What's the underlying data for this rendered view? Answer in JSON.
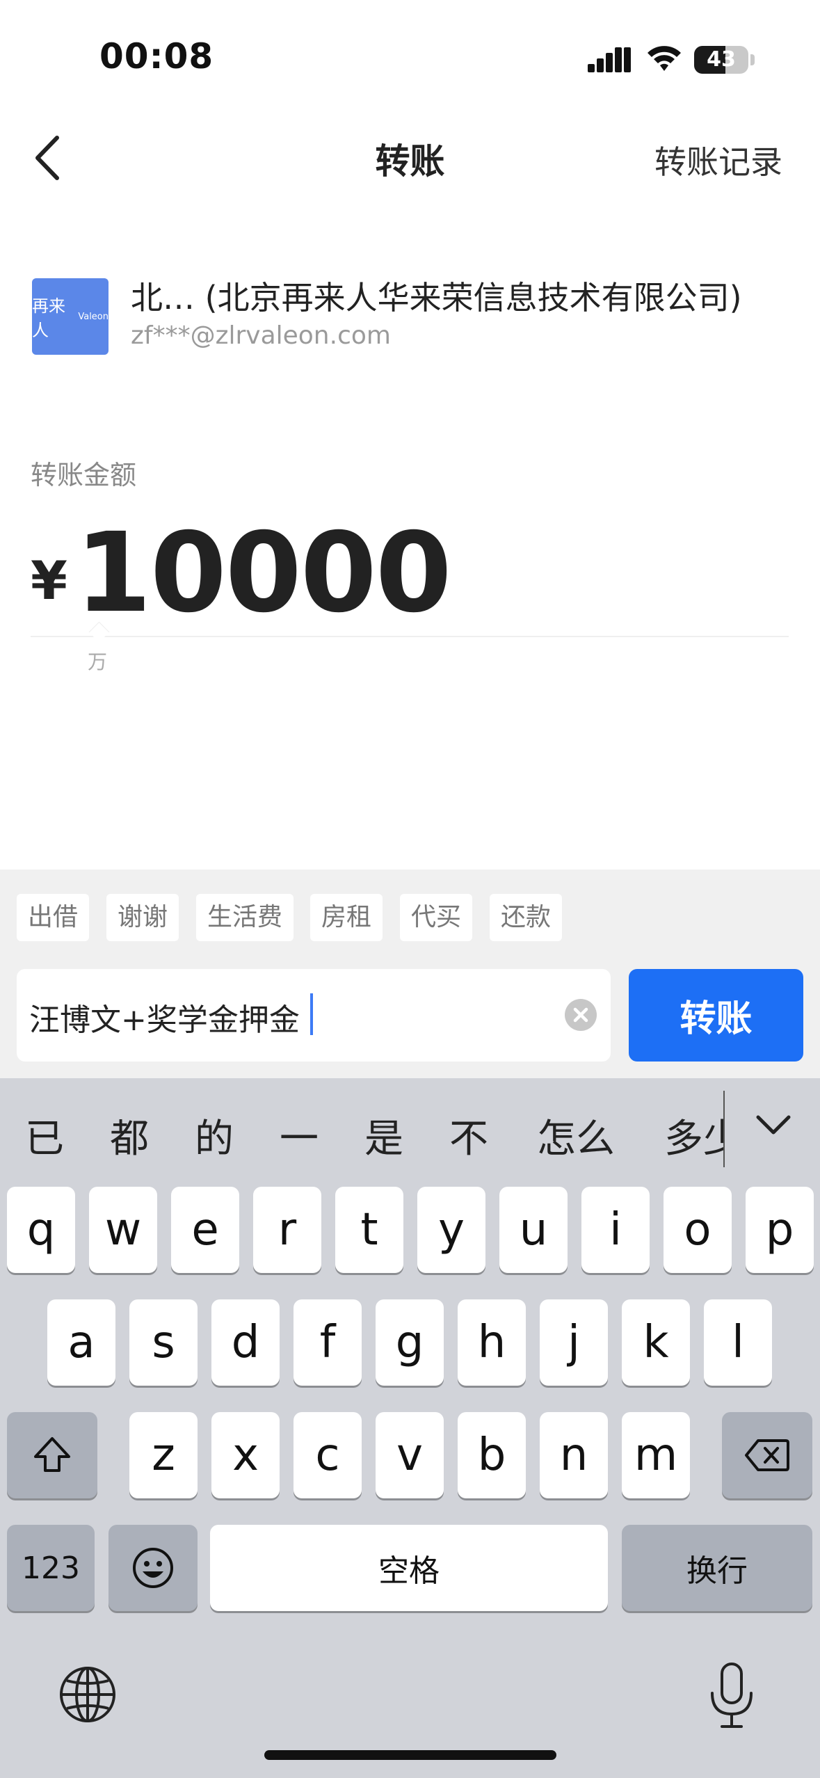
{
  "status_bar": {
    "time": "00:08",
    "battery": "43"
  },
  "nav": {
    "title": "转账",
    "record_link": "转账记录"
  },
  "payee": {
    "avatar_text": "再来人",
    "avatar_sup": "Valeon",
    "name": "北… (北京再来人华来荣信息技术有限公司)",
    "account": "zf***@zlrvaleon.com"
  },
  "amount": {
    "label": "转账金额",
    "currency": "¥",
    "value": "10000",
    "unit_hint": "万"
  },
  "remark": {
    "chips": [
      "出借",
      "谢谢",
      "生活费",
      "房租",
      "代买",
      "还款"
    ],
    "value": "汪博文+奖学金押金",
    "submit_label": "转账"
  },
  "keyboard": {
    "candidates": [
      "已",
      "都",
      "的",
      "一",
      "是",
      "不",
      "怎么",
      "多少"
    ],
    "row1": [
      "q",
      "w",
      "e",
      "r",
      "t",
      "y",
      "u",
      "i",
      "o",
      "p"
    ],
    "row2": [
      "a",
      "s",
      "d",
      "f",
      "g",
      "h",
      "j",
      "k",
      "l"
    ],
    "row3": [
      "z",
      "x",
      "c",
      "v",
      "b",
      "n",
      "m"
    ],
    "numbers_key": "123",
    "space_key": "空格",
    "return_key": "换行"
  },
  "colors": {
    "accent": "#1d6ff5",
    "avatar_bg": "#5b87e8",
    "keyboard_bg": "#d1d3d9"
  }
}
